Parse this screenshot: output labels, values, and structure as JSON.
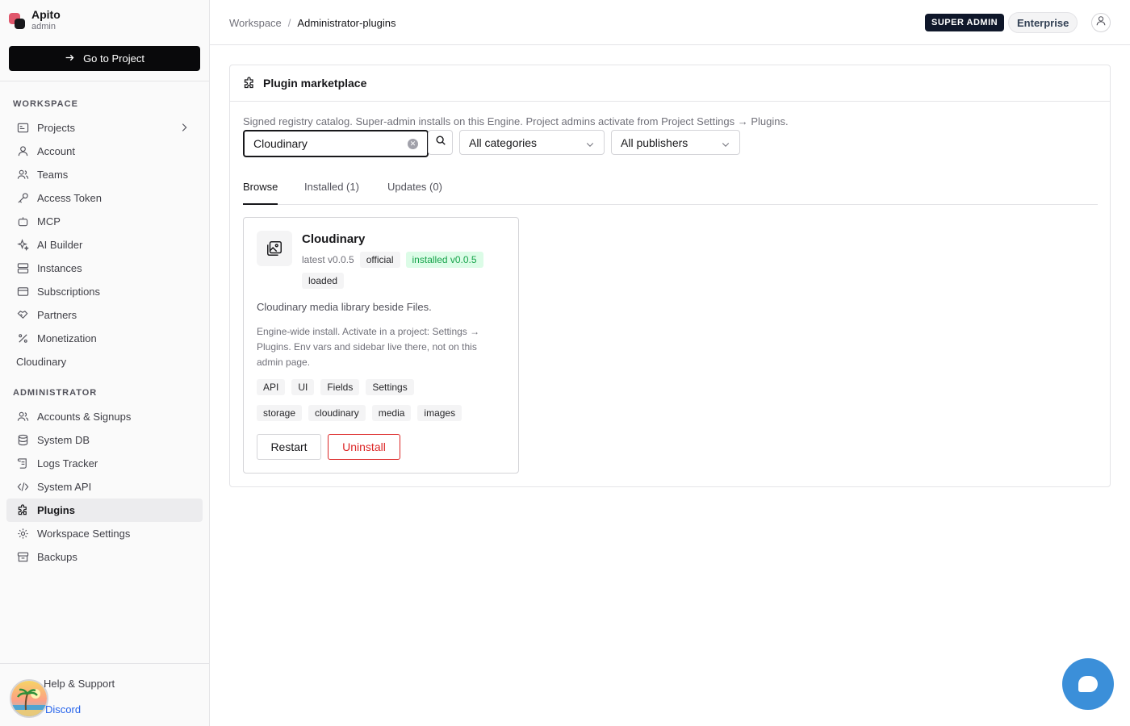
{
  "brand": {
    "name": "Apito",
    "sub": "admin",
    "go_to_project": "Go to Project"
  },
  "sidebar": {
    "workspace_title": "WORKSPACE",
    "workspace_items": [
      {
        "label": "Projects",
        "icon": "projects-icon"
      },
      {
        "label": "Account",
        "icon": "user-icon"
      },
      {
        "label": "Teams",
        "icon": "team-icon"
      },
      {
        "label": "Access Token",
        "icon": "key-icon"
      },
      {
        "label": "MCP",
        "icon": "robot-icon"
      },
      {
        "label": "AI Builder",
        "icon": "sparkles-icon"
      },
      {
        "label": "Instances",
        "icon": "server-icon"
      },
      {
        "label": "Subscriptions",
        "icon": "credit-card-icon"
      },
      {
        "label": "Partners",
        "icon": "handshake-icon"
      },
      {
        "label": "Monetization",
        "icon": "percent-icon"
      },
      {
        "label": "Cloudinary",
        "icon": ""
      }
    ],
    "admin_title": "ADMINISTRATOR",
    "admin_items": [
      {
        "label": "Accounts & Signups",
        "icon": "users-icon"
      },
      {
        "label": "System DB",
        "icon": "database-icon"
      },
      {
        "label": "Logs Tracker",
        "icon": "scroll-icon"
      },
      {
        "label": "System API",
        "icon": "code-icon"
      },
      {
        "label": "Plugins",
        "icon": "puzzle-icon",
        "active": true
      },
      {
        "label": "Workspace Settings",
        "icon": "gear-icon"
      },
      {
        "label": "Backups",
        "icon": "archive-icon"
      }
    ],
    "help": "Help & Support",
    "discord": "Discord"
  },
  "header": {
    "breadcrumb": [
      "Workspace",
      "Administrator-plugins"
    ],
    "badge_admin": "SUPER ADMIN",
    "badge_plan": "Enterprise"
  },
  "panel": {
    "title": "Plugin marketplace",
    "description": "Signed registry catalog. Super-admin installs on this Engine. Project admins activate from Project Settings → Plugins.",
    "search_value": "Cloudinary",
    "category_select": "All categories",
    "publisher_select": "All publishers",
    "tabs": [
      "Browse",
      "Installed (1)",
      "Updates (0)"
    ],
    "active_tab": "Browse"
  },
  "plugin": {
    "name": "Cloudinary",
    "latest": "latest v0.0.5",
    "official": "official",
    "installed": "installed v0.0.5",
    "loaded": "loaded",
    "description": "Cloudinary media library beside Files.",
    "note": "Engine-wide install. Activate in a project: Settings → Plugins. Env vars and sidebar live there, not on this admin page.",
    "capabilities": [
      "API",
      "UI",
      "Fields",
      "Settings"
    ],
    "keywords": [
      "storage",
      "cloudinary",
      "media",
      "images"
    ],
    "restart": "Restart",
    "uninstall": "Uninstall"
  },
  "colors": {
    "accent": "#09090b",
    "danger": "#dc2626",
    "success": "#16a34a",
    "chat": "#3b8fd9",
    "brand": "#e0576c"
  }
}
